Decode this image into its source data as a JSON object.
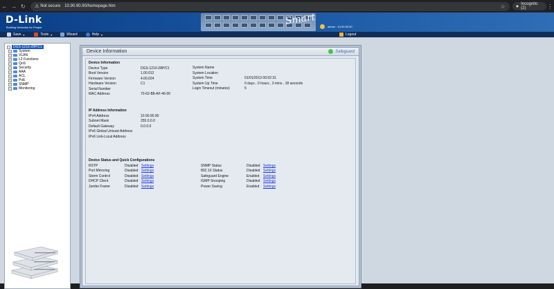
{
  "browser": {
    "not_secure": "Not secure",
    "url": "10.90.90.90/homepage.htm",
    "profile": "Incognito (2)"
  },
  "banner": {
    "brand": "D-Link",
    "tagline": "Building Networks for People",
    "smart": "Smart",
    "user": "admin - 10.90.90.90"
  },
  "menu": {
    "save": "Save",
    "tools": "Tools",
    "wizard": "Wizard",
    "help": "Help",
    "logout": "Logout"
  },
  "tree": [
    {
      "label": "DGS-1210-28P/C1",
      "root": true
    },
    {
      "label": "System"
    },
    {
      "label": "VLAN"
    },
    {
      "label": "L2 Functions"
    },
    {
      "label": "QoS"
    },
    {
      "label": "Security"
    },
    {
      "label": "AAA"
    },
    {
      "label": "ACL"
    },
    {
      "label": "PoE"
    },
    {
      "label": "SNMP"
    },
    {
      "label": "Monitoring"
    }
  ],
  "panel": {
    "title": "Device Information",
    "safeguard": "Safeguard"
  },
  "device_info": {
    "title": "Device Information",
    "left": [
      {
        "label": "Device Type",
        "value": "DGS-1210-28P/C1"
      },
      {
        "label": "Boot Version",
        "value": "1.00.012"
      },
      {
        "label": "Firmware Version",
        "value": "4.00.024"
      },
      {
        "label": "Hardware Version",
        "value": "C1"
      },
      {
        "label": "Serial Number",
        "value": ""
      },
      {
        "label": "MAC Address",
        "value": "70-62-B8-AF-46-00"
      }
    ],
    "right": [
      {
        "label": "System Name",
        "value": ""
      },
      {
        "label": "System Location",
        "value": ""
      },
      {
        "label": "System Time",
        "value": "01/01/2013 00:02:31"
      },
      {
        "label": "System Up Time",
        "value": "0 days , 0 hours , 3 mins , 18 seconds"
      },
      {
        "label": "Login Timeout (minutes)",
        "value": "5"
      }
    ]
  },
  "ip_info": {
    "title": "IP Address Information",
    "rows": [
      {
        "label": "IPv4 Address",
        "value": "10.90.90.90"
      },
      {
        "label": "Subnet Mask",
        "value": "255.0.0.0"
      },
      {
        "label": "Default Gateway",
        "value": "0.0.0.0"
      },
      {
        "label": "IPv6 Global Unicast Address",
        "value": ""
      },
      {
        "label": "IPv6 Link-Local Address",
        "value": ""
      }
    ]
  },
  "status": {
    "title": "Device Status and Quick Configurations",
    "left": [
      {
        "label": "RSTP",
        "state": "Disabled",
        "link": "Settings"
      },
      {
        "label": "Port Mirroring",
        "state": "Disabled",
        "link": "Settings"
      },
      {
        "label": "Storm Control",
        "state": "Disabled",
        "link": "Settings"
      },
      {
        "label": "DHCP Client",
        "state": "Disabled",
        "link": "Settings"
      },
      {
        "label": "Jumbo Frame",
        "state": "Disabled",
        "link": "Settings"
      }
    ],
    "right": [
      {
        "label": "SNMP Status",
        "state": "Disabled",
        "link": "Settings"
      },
      {
        "label": "802.1X Status",
        "state": "Disabled",
        "link": "Settings"
      },
      {
        "label": "Safeguard Engine",
        "state": "Enabled",
        "link": "Settings"
      },
      {
        "label": "IGMP Snooping",
        "state": "Disabled",
        "link": "Settings"
      },
      {
        "label": "Power Saving",
        "state": "Enabled",
        "link": "Settings"
      }
    ]
  }
}
